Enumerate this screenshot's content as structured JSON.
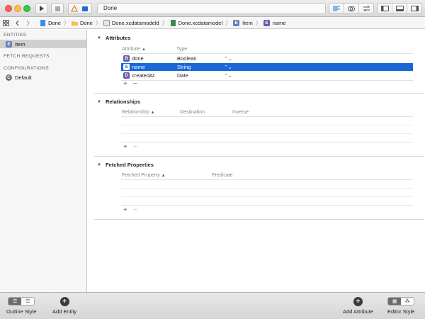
{
  "toolbar": {
    "activity_text": "Done",
    "icons": [
      "play-icon",
      "stop-icon",
      "scheme-icon",
      "editor-standard-icon",
      "editor-assistant-icon",
      "editor-version-icon",
      "navigator-panel-icon",
      "debug-panel-icon",
      "utilities-panel-icon"
    ]
  },
  "jumpbar": {
    "crumbs": [
      "Done",
      "Done",
      "Done.xcdatamodeld",
      "Done.xcdatamodel",
      "Item",
      "name"
    ]
  },
  "sidebar": {
    "entities_header": "ENTITIES",
    "entity_badge": "E",
    "entity_item": "Item",
    "fetch_header": "FETCH REQUESTS",
    "config_header": "CONFIGURATIONS",
    "config_badge": "C",
    "config_item": "Default"
  },
  "attributes": {
    "title": "Attributes",
    "col_attribute": "Attribute",
    "col_type": "Type",
    "rows": [
      {
        "badge": "B",
        "name": "done",
        "type": "Boolean"
      },
      {
        "badge": "S",
        "name": "name",
        "type": "String"
      },
      {
        "badge": "D",
        "name": "createdAt",
        "type": "Date"
      }
    ]
  },
  "relationships": {
    "title": "Relationships",
    "col_relationship": "Relationship",
    "col_destination": "Destination",
    "col_inverse": "Inverse"
  },
  "fetched": {
    "title": "Fetched Properties",
    "col_property": "Fetched Property",
    "col_predicate": "Predicate"
  },
  "bottom": {
    "outline_style": "Outline Style",
    "add_entity": "Add Entity",
    "add_attribute": "Add Attribute",
    "editor_style": "Editor Style"
  }
}
